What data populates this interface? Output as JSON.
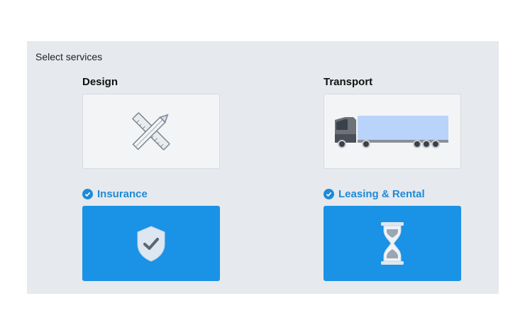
{
  "panel": {
    "title": "Select services"
  },
  "services": [
    {
      "label": "Design",
      "selected": false,
      "icon": "pencil-ruler-icon"
    },
    {
      "label": "Transport",
      "selected": false,
      "icon": "truck-icon"
    },
    {
      "label": "Insurance",
      "selected": true,
      "icon": "shield-check-icon"
    },
    {
      "label": "Leasing & Rental",
      "selected": true,
      "icon": "hourglass-icon"
    }
  ],
  "colors": {
    "accent": "#1a92e5",
    "panel_bg": "#e6e9ed",
    "card_bg": "#f3f4f5"
  }
}
